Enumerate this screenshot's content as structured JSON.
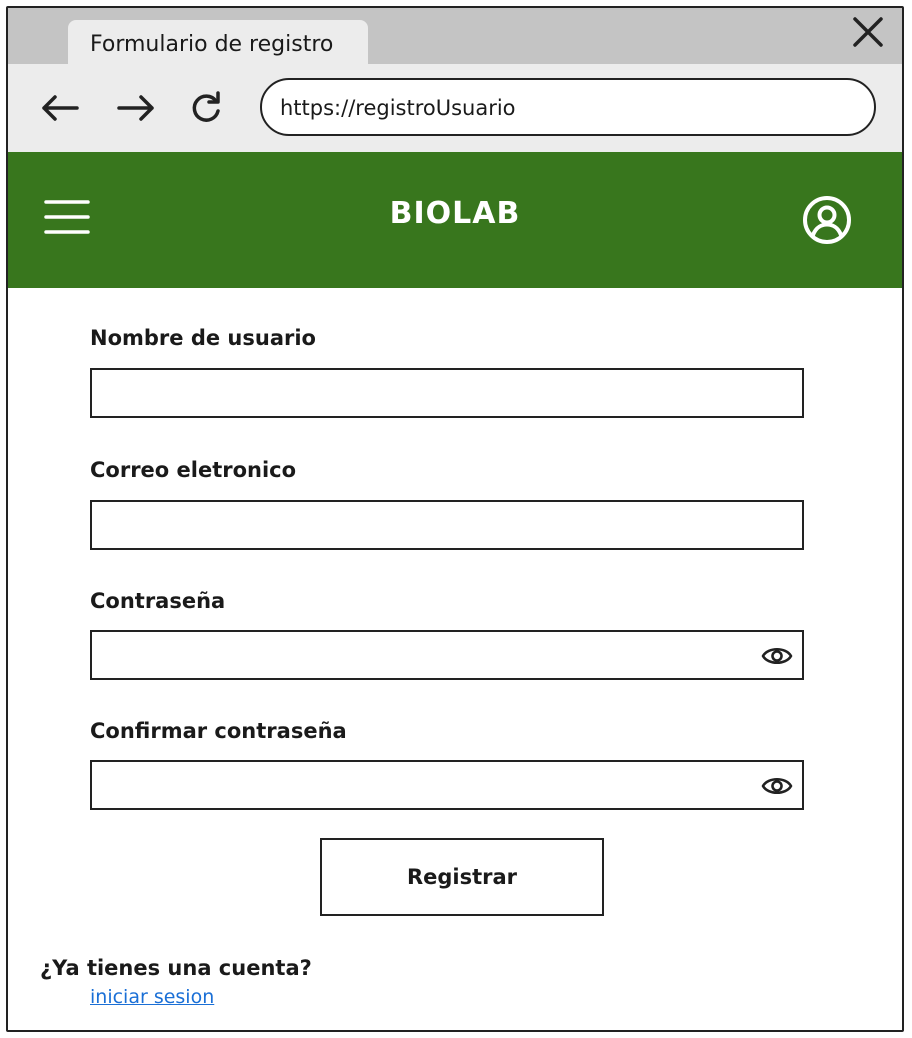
{
  "browser": {
    "tab_title": "Formulario de registro",
    "url": "https://registroUsuario"
  },
  "header": {
    "brand": "BIOLAB",
    "bg_color": "#38761d"
  },
  "form": {
    "fields": [
      {
        "label": "Nombre de usuario",
        "value": ""
      },
      {
        "label": "Correo eletronico",
        "value": ""
      },
      {
        "label": "Contraseña",
        "value": ""
      },
      {
        "label": "Confirmar contraseña",
        "value": ""
      }
    ],
    "submit_label": "Registrar"
  },
  "footer": {
    "question": "¿Ya tienes una cuenta?",
    "link_label": "iniciar sesion",
    "link_color": "#1a6fd6"
  },
  "icons": [
    "close-icon",
    "back-arrow-icon",
    "forward-arrow-icon",
    "reload-icon",
    "hamburger-menu-icon",
    "user-account-icon",
    "eye-icon"
  ]
}
